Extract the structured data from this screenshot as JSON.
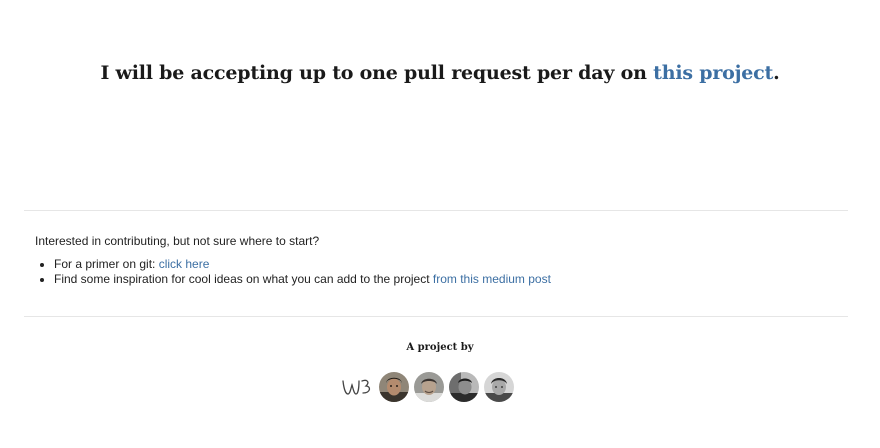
{
  "headline": {
    "text": "I will be accepting up to one pull request per day on ",
    "link_text": "this project",
    "suffix": "."
  },
  "contributing": {
    "intro": "Interested in contributing, but not sure where to start?",
    "items": [
      {
        "text": "For a primer on git: ",
        "link_text": "click here"
      },
      {
        "text": "Find some inspiration for cool ideas on what you can add to the project ",
        "link_text": "from this medium post"
      }
    ]
  },
  "footer": {
    "title": "A project by",
    "logo": "wb-logo",
    "avatars": [
      "avatar-1",
      "avatar-2",
      "avatar-3",
      "avatar-4"
    ]
  },
  "colors": {
    "link": "#3c6fa3",
    "divider": "#e6e6e6"
  }
}
